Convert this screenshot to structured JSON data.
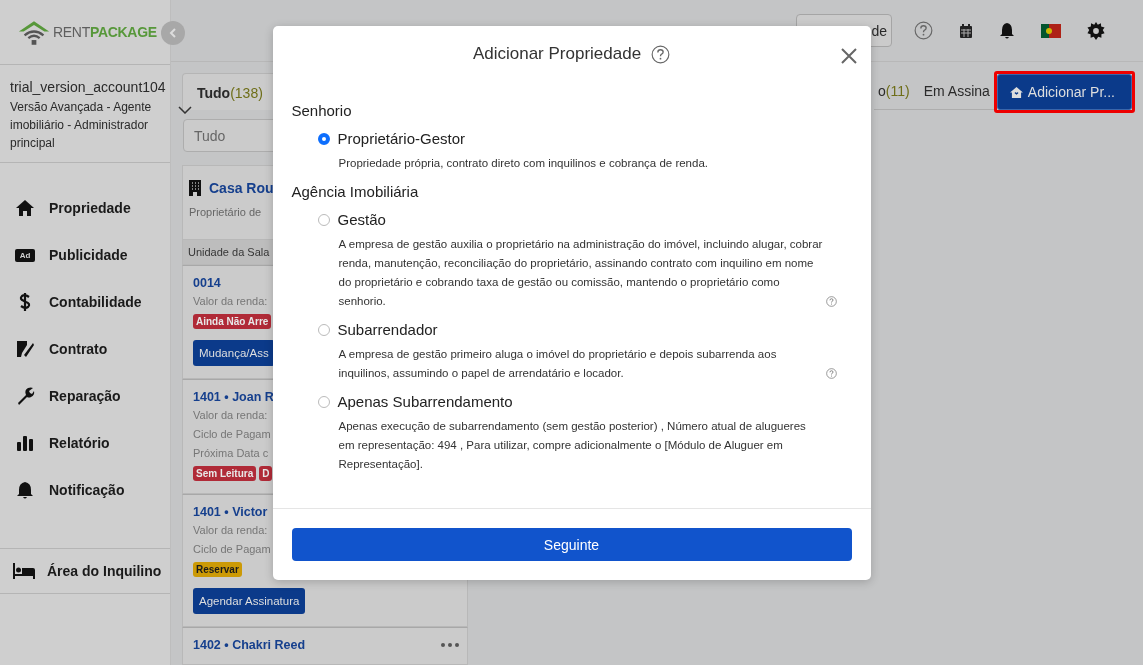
{
  "sidebar": {
    "brand": {
      "part_1": "RENT",
      "part_2": "PACKAGE"
    },
    "account": {
      "username": "trial_version_account104",
      "role": "Versão Avançada - Agente imobiliário - Administrador principal"
    },
    "nav": [
      {
        "label": "Propriedade"
      },
      {
        "label": "Publicidade",
        "badge_text": "Ad"
      },
      {
        "label": "Contabilidade"
      },
      {
        "label": "Contrato"
      },
      {
        "label": "Reparação"
      },
      {
        "label": "Relatório"
      },
      {
        "label": "Notificação"
      }
    ],
    "tenant_area": {
      "label": "Área do Inquilino"
    }
  },
  "header": {
    "button_label": "de"
  },
  "tabs": [
    {
      "label": "Tudo",
      "count": "(138)",
      "selected": true
    },
    {
      "label": "o",
      "count": "(11)",
      "selected": false
    },
    {
      "label": "Em Assina",
      "selected": false
    }
  ],
  "add_button": {
    "label": "Adicionar Pr..."
  },
  "filter": {
    "value": "Tudo"
  },
  "building": {
    "name": "Casa Rou",
    "subtitle": "Proprietário de"
  },
  "group_header": "Unidade da Sala",
  "units": [
    {
      "title": "0014",
      "lines": [
        "Valor da renda:"
      ],
      "tags": [
        {
          "label": "Ainda Não Arre",
          "color": "#b02a37"
        }
      ],
      "action": "Mudança/Ass"
    },
    {
      "title": "1401 • Joan R",
      "lines": [
        "Valor da renda:",
        "Ciclo de Pagam",
        "Próxima Data c"
      ],
      "tags": [
        {
          "label": "Sem Leitura",
          "color": "#b02a37"
        },
        {
          "label": "D",
          "color": "#b02a37"
        }
      ]
    },
    {
      "title": "1401 • Victor",
      "lines": [
        "Valor da renda:",
        "Ciclo de Pagam"
      ],
      "tags": [
        {
          "label": "Reservar",
          "color": "#cc9a06"
        }
      ],
      "action": "Agendar Assinatura"
    },
    {
      "title": "1402 • Chakri Reed",
      "has_menu": true
    }
  ],
  "modal": {
    "title": "Adicionar Propriedade",
    "sections": [
      {
        "heading": "Senhorio",
        "options": [
          {
            "label": "Proprietário-Gestor",
            "description": "Propriedade própria, contrato direto com inquilinos e cobrança de renda.",
            "selected": true
          }
        ]
      },
      {
        "heading": "Agência Imobiliária",
        "options": [
          {
            "label": "Gestão",
            "description": "A empresa de gestão auxilia o proprietário na administração do imóvel, incluindo alugar, cobrar renda, manutenção, reconciliação do proprietário, assinando contrato com inquilino em nome do proprietário e cobrando taxa de gestão ou comissão, mantendo o proprietário como senhorio.",
            "has_help": true,
            "selected": false
          },
          {
            "label": "Subarrendador",
            "description": "A empresa de gestão primeiro aluga o imóvel do proprietário e depois subarrenda aos inquilinos, assumindo o papel de arrendatário e locador.",
            "has_help": true,
            "selected": false
          },
          {
            "label": "Apenas Subarrendamento",
            "description": "Apenas execução de subarrendamento (sem gestão posterior) , Número atual de alugueres em representação: 494 , Para utilizar, compre adicionalmente o [Módulo de Aluguer em Representação].",
            "selected": false
          }
        ]
      }
    ],
    "next_button": "Seguinte"
  }
}
